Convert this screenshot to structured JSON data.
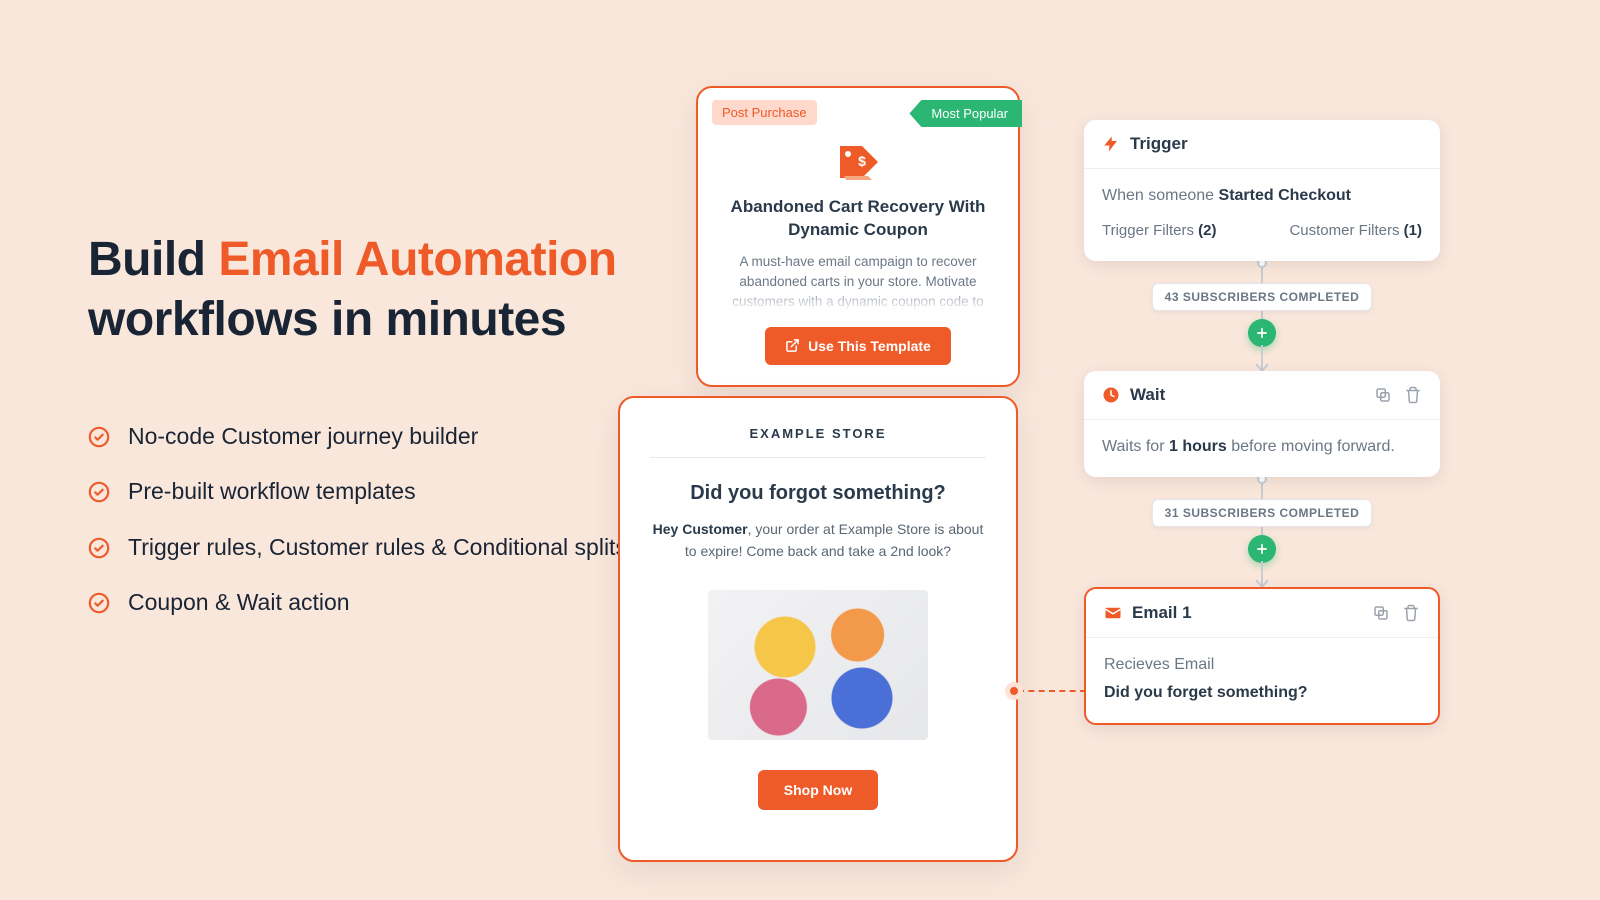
{
  "hero": {
    "pre": "Build ",
    "accent": "Email Automation",
    "post": " workflows in minutes"
  },
  "features": [
    "No-code Customer journey builder",
    "Pre-built workflow templates",
    "Trigger rules, Customer rules & Conditional splits",
    "Coupon & Wait action"
  ],
  "template_card": {
    "tag": "Post Purchase",
    "ribbon": "Most Popular",
    "title": "Abandoned Cart Recovery With Dynamic Coupon",
    "desc": "A must-have email campaign to recover abandoned carts in your store. Motivate customers with a dynamic coupon code to",
    "button": "Use This Template"
  },
  "email_preview": {
    "store": "EXAMPLE STORE",
    "heading": "Did you forgot something?",
    "body_prefix": "Hey Customer",
    "body_rest": ", your order at Example Store is about to expire! Come back and take a 2nd look?",
    "shop_button": "Shop Now"
  },
  "workflow": {
    "trigger": {
      "title": "Trigger",
      "line_pre": "When someone ",
      "line_bold": "Started Checkout",
      "filters_left_label": "Trigger Filters ",
      "filters_left_count": "(2)",
      "filters_right_label": "Customer Filters ",
      "filters_right_count": "(1)"
    },
    "conn1": "43 SUBSCRIBERS COMPLETED",
    "wait": {
      "title": "Wait",
      "line_pre": "Waits for ",
      "line_bold": "1 hours",
      "line_post": " before moving forward."
    },
    "conn2": "31 SUBSCRIBERS COMPLETED",
    "email": {
      "title": "Email 1",
      "subtitle": "Recieves Email",
      "subject": "Did you forget something?"
    }
  }
}
